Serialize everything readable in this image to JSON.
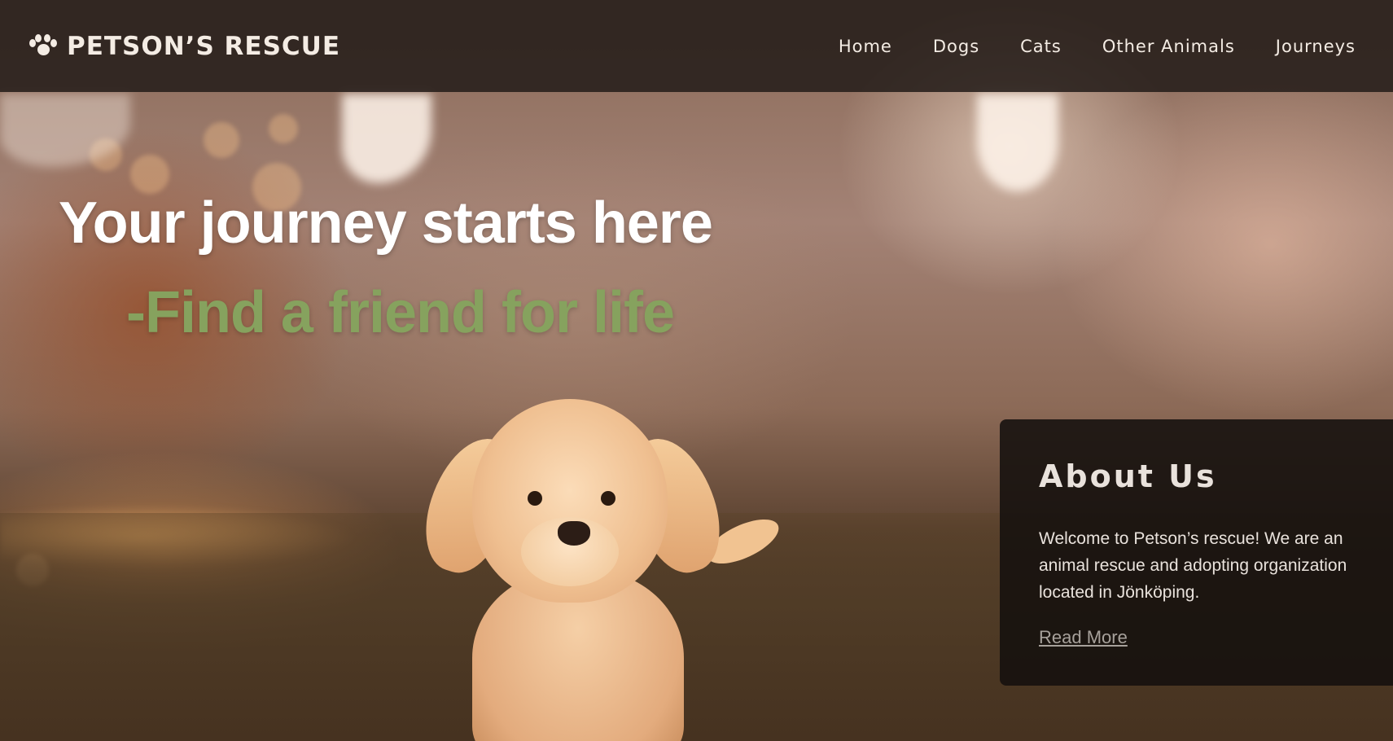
{
  "brand": {
    "name": "PETSON’S RESCUE",
    "icon": "paw-icon"
  },
  "nav": {
    "items": [
      {
        "label": "Home"
      },
      {
        "label": "Dogs"
      },
      {
        "label": "Cats"
      },
      {
        "label": "Other Animals"
      },
      {
        "label": "Journeys"
      }
    ]
  },
  "hero": {
    "headline": "Your journey starts here",
    "subline": "-Find a friend for life",
    "image": "golden-retriever-puppy-running"
  },
  "about": {
    "title": "About Us",
    "text": "Welcome to Petson’s rescue! We are an animal rescue and adopting organization located in Jönköping.",
    "link_label": "Read More"
  },
  "colors": {
    "nav_bg": "#261e1a",
    "accent_green": "#86a25e",
    "text_light": "#f4ece4",
    "card_bg": "#14100e",
    "link_muted": "#a7a19b"
  }
}
